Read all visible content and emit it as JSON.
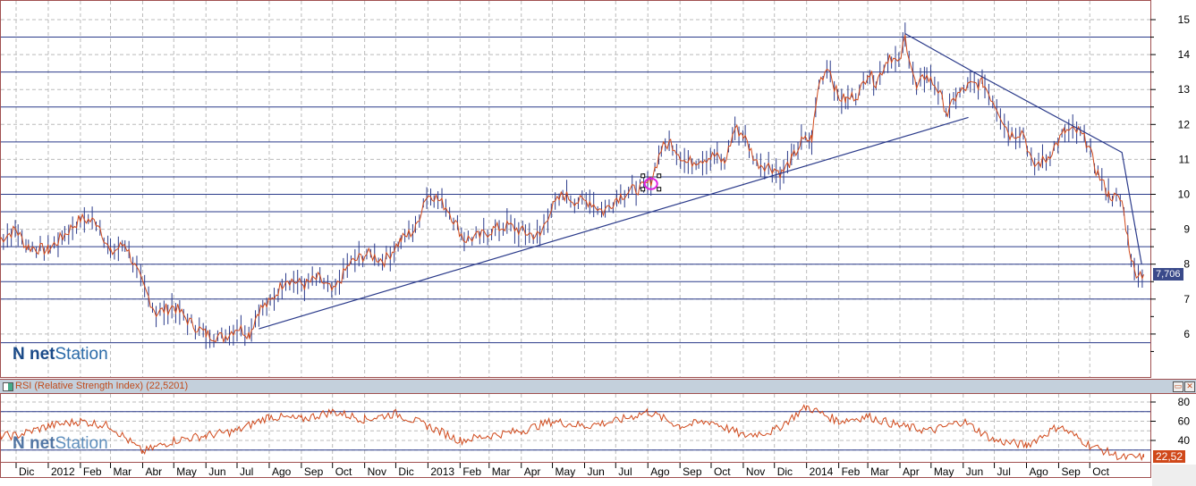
{
  "chart_data": [
    {
      "type": "ohlc-line",
      "ylim": [
        5,
        15.5
      ],
      "y_ticks": [
        6,
        7,
        8,
        9,
        10,
        11,
        12,
        13,
        14,
        15
      ],
      "grid": true,
      "last_value_label": "7,706",
      "horizontal_levels": [
        14.5,
        13.5,
        12.5,
        11.5,
        10.5,
        10,
        9.5,
        8.5,
        8,
        7.5,
        7,
        5.75
      ],
      "series": [
        {
          "dates": [
            "2011-11-15",
            "2011-12-01",
            "2011-12-11",
            "2012-01-01",
            "2012-01-15",
            "2012-02-01",
            "2012-02-18",
            "2012-03-01",
            "2012-03-15",
            "2012-04-01",
            "2012-04-14",
            "2012-05-01",
            "2012-05-18",
            "2012-06-01",
            "2012-06-18",
            "2012-07-01",
            "2012-07-13",
            "2012-07-22",
            "2012-08-02",
            "2012-08-17",
            "2012-09-04",
            "2012-09-17",
            "2012-10-02",
            "2012-10-17",
            "2012-11-03",
            "2012-11-20",
            "2012-12-06",
            "2012-12-20",
            "2012-12-29",
            "2013-01-05",
            "2013-01-20",
            "2013-02-05",
            "2013-02-20",
            "2013-03-05",
            "2013-03-20",
            "2013-04-05",
            "2013-04-19",
            "2013-04-28",
            "2013-05-11",
            "2013-05-24",
            "2013-06-06",
            "2013-06-19",
            "2013-07-02",
            "2013-07-15",
            "2013-07-28",
            "2013-08-04",
            "2013-08-14",
            "2013-08-23",
            "2013-09-07",
            "2013-09-19",
            "2013-10-05",
            "2013-10-14",
            "2013-10-24",
            "2013-11-01",
            "2013-11-14",
            "2013-11-27",
            "2013-12-08",
            "2013-12-18",
            "2013-12-27",
            "2014-01-06",
            "2014-01-13",
            "2014-01-22",
            "2014-01-31",
            "2014-02-08",
            "2014-02-21",
            "2014-03-01",
            "2014-03-09",
            "2014-03-22",
            "2014-03-31",
            "2014-04-06",
            "2014-04-17",
            "2014-04-25",
            "2014-05-06",
            "2014-05-17",
            "2014-05-25",
            "2014-06-06",
            "2014-06-20",
            "2014-07-05",
            "2014-07-16",
            "2014-07-29",
            "2014-08-07",
            "2014-08-20",
            "2014-09-07",
            "2014-09-20",
            "2014-09-28",
            "2014-10-07",
            "2014-10-19",
            "2014-11-01",
            "2014-11-08",
            "2014-11-13",
            "2014-11-22"
          ],
          "values": [
            8.7,
            9.0,
            8.5,
            8.4,
            8.8,
            9.3,
            9.2,
            8.3,
            8.6,
            7.4,
            6.6,
            6.8,
            6.3,
            6.0,
            5.9,
            6.2,
            6.0,
            6.7,
            6.9,
            7.6,
            7.4,
            7.6,
            7.2,
            8.0,
            8.3,
            8.1,
            8.7,
            9.0,
            9.9,
            10.0,
            9.6,
            8.7,
            8.8,
            9.0,
            9.1,
            8.9,
            8.8,
            9.5,
            10.0,
            9.8,
            9.8,
            9.5,
            9.9,
            10.1,
            10.2,
            10.4,
            11.3,
            11.5,
            10.9,
            11.0,
            11.1,
            10.9,
            11.9,
            11.7,
            10.9,
            10.8,
            10.6,
            11.0,
            11.5,
            11.6,
            13.2,
            13.7,
            12.8,
            12.7,
            12.9,
            13.5,
            13.2,
            14.0,
            13.7,
            14.5,
            13.0,
            13.4,
            13.1,
            12.3,
            12.8,
            13.1,
            13.2,
            12.4,
            11.7,
            11.8,
            10.8,
            11.0,
            11.8,
            11.8,
            11.5,
            10.7,
            10.0,
            9.8,
            8.5,
            7.8,
            7.706
          ]
        }
      ],
      "trendlines": [
        {
          "points": [
            [
              "2012-07-22",
              6.15
            ],
            [
              "2014-06-06",
              12.2
            ]
          ]
        },
        {
          "points": [
            [
              "2014-04-06",
              14.6
            ],
            [
              "2014-06-20",
              13.35
            ],
            [
              "2014-11-01",
              11.2
            ],
            [
              "2014-11-20",
              8.0
            ]
          ]
        }
      ],
      "marker": {
        "date": "2013-08-04",
        "value": 10.3,
        "color": "#e020e0"
      }
    },
    {
      "type": "line",
      "title": "RSI (Relative Strength Index) (22,5201)",
      "ylim": [
        20,
        88
      ],
      "y_ticks": [
        40,
        60,
        80
      ],
      "levels": [
        70,
        30
      ],
      "last_value_label": "22,52",
      "dates": [
        "2011-11-15",
        "2011-12-01",
        "2012-01-01",
        "2012-02-01",
        "2012-03-01",
        "2012-04-01",
        "2012-05-01",
        "2012-06-01",
        "2012-07-01",
        "2012-08-01",
        "2012-09-01",
        "2012-10-01",
        "2012-11-01",
        "2012-12-01",
        "2013-01-01",
        "2013-02-01",
        "2013-03-01",
        "2013-04-01",
        "2013-05-01",
        "2013-06-01",
        "2013-07-01",
        "2013-08-01",
        "2013-09-01",
        "2013-10-01",
        "2013-11-01",
        "2013-12-01",
        "2014-01-01",
        "2014-02-01",
        "2014-03-01",
        "2014-04-01",
        "2014-05-01",
        "2014-06-01",
        "2014-07-01",
        "2014-08-01",
        "2014-09-01",
        "2014-10-01",
        "2014-11-01",
        "2014-11-22"
      ],
      "values": [
        45,
        45,
        55,
        60,
        55,
        28,
        40,
        45,
        50,
        65,
        62,
        70,
        62,
        68,
        55,
        40,
        45,
        50,
        60,
        55,
        60,
        70,
        55,
        60,
        45,
        50,
        75,
        60,
        65,
        55,
        50,
        60,
        40,
        35,
        55,
        35,
        22,
        22.52
      ]
    }
  ],
  "x_axis": {
    "labels": [
      "Dic",
      "2012",
      "Feb",
      "Mar",
      "Abr",
      "May",
      "Jun",
      "Jul",
      "Ago",
      "Sep",
      "Oct",
      "Nov",
      "Dic",
      "2013",
      "Feb",
      "Mar",
      "Apr",
      "May",
      "Jun",
      "Jul",
      "Ago",
      "Sep",
      "Oct",
      "Nov",
      "Dic",
      "2014",
      "Feb",
      "Mar",
      "Apr",
      "May",
      "Jun",
      "Jul",
      "Ago",
      "Sep",
      "Oct"
    ],
    "dates": [
      "2011-12-01",
      "2012-01-01",
      "2012-02-01",
      "2012-03-01",
      "2012-04-01",
      "2012-05-01",
      "2012-06-01",
      "2012-07-01",
      "2012-08-01",
      "2012-09-01",
      "2012-10-01",
      "2012-11-01",
      "2012-12-01",
      "2013-01-01",
      "2013-02-01",
      "2013-03-01",
      "2013-04-01",
      "2013-05-01",
      "2013-06-01",
      "2013-07-01",
      "2013-08-01",
      "2013-09-01",
      "2013-10-01",
      "2013-11-01",
      "2013-12-01",
      "2014-01-01",
      "2014-02-01",
      "2014-03-01",
      "2014-04-01",
      "2014-05-01",
      "2014-06-01",
      "2014-07-01",
      "2014-08-01",
      "2014-09-01",
      "2014-10-01"
    ]
  },
  "logo": {
    "brand_bold": "net",
    "brand_rest": "Station"
  },
  "panel": {
    "maximize": "▭",
    "close": "✕"
  },
  "colors": {
    "price": "#d0481a",
    "bars": "#2a3a8a",
    "levels": "#2a3a8a",
    "grid": "#bbbbbb",
    "frame": "#a05050"
  }
}
